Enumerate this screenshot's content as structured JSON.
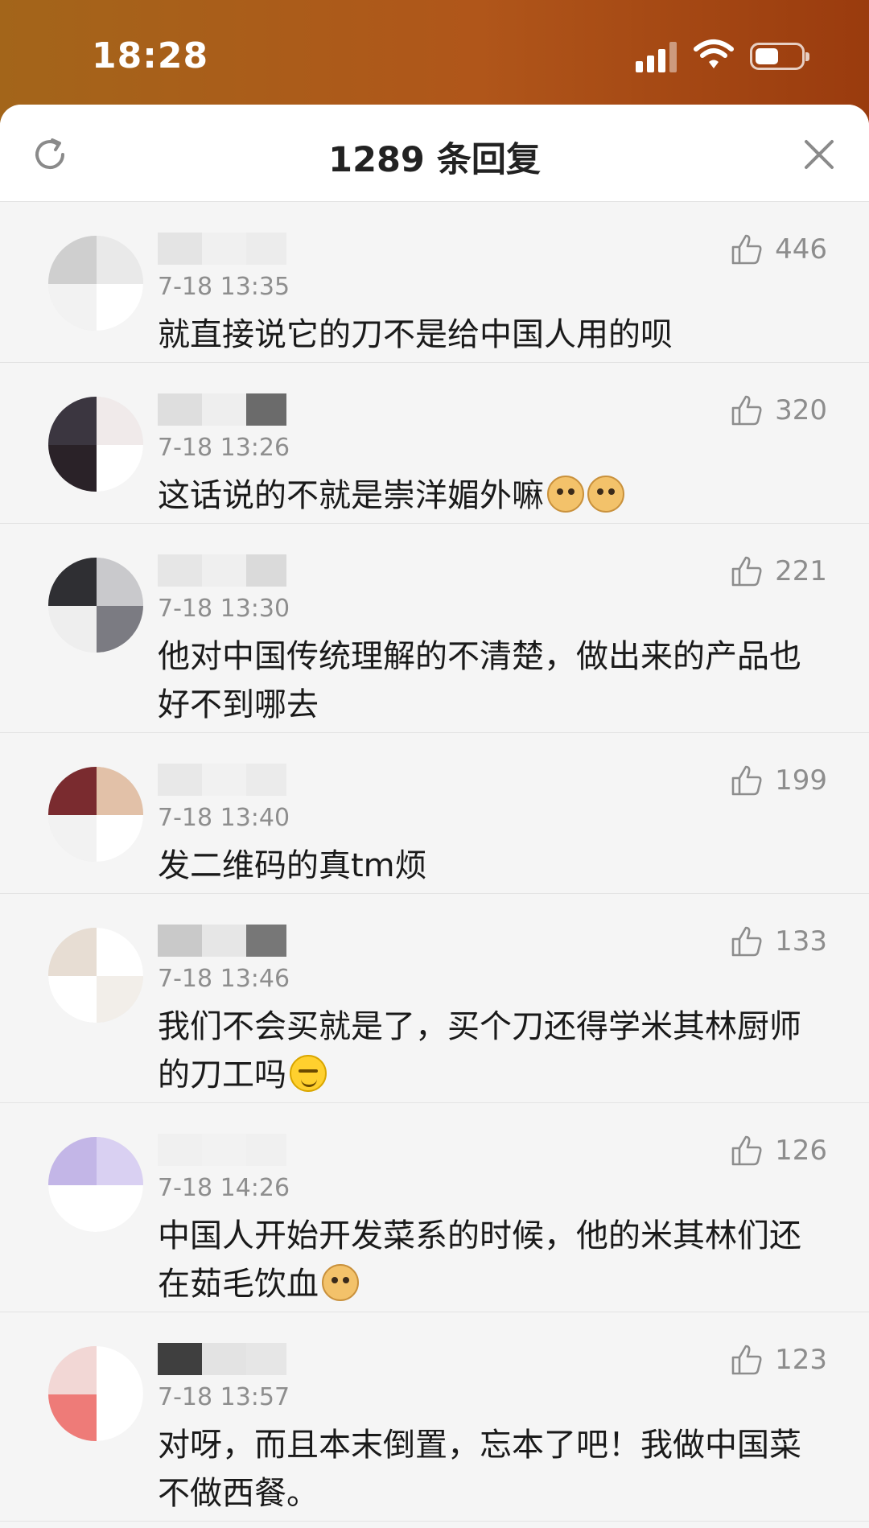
{
  "status_bar": {
    "time": "18:28"
  },
  "header": {
    "title": "1289 条回复"
  },
  "comments": [
    {
      "likes": "446",
      "date": "7-18 13:35",
      "text": "就直接说它的刀不是给中国人用的呗",
      "emoji": []
    },
    {
      "likes": "320",
      "date": "7-18 13:26",
      "text": "这话说的不就是崇洋媚外嘛",
      "emoji": [
        "doge-emoji",
        "doge-emoji"
      ]
    },
    {
      "likes": "221",
      "date": "7-18 13:30",
      "text": "他对中国传统理解的不清楚，做出来的产品也好不到哪去",
      "emoji": []
    },
    {
      "likes": "199",
      "date": "7-18 13:40",
      "text": "发二维码的真tm烦",
      "emoji": []
    },
    {
      "likes": "133",
      "date": "7-18 13:46",
      "text": "我们不会买就是了，买个刀还得学米其林厨师的刀工吗",
      "emoji": [
        "sleepy-emoji"
      ]
    },
    {
      "likes": "126",
      "date": "7-18 14:26",
      "text": "中国人开始开发菜系的时候，他的米其林们还在茹毛饮血",
      "emoji": [
        "doge-emoji"
      ]
    },
    {
      "likes": "123",
      "date": "7-18 13:57",
      "text": "对呀，而且本末倒置，忘本了吧！我做中国菜不做西餐。",
      "emoji": []
    }
  ]
}
